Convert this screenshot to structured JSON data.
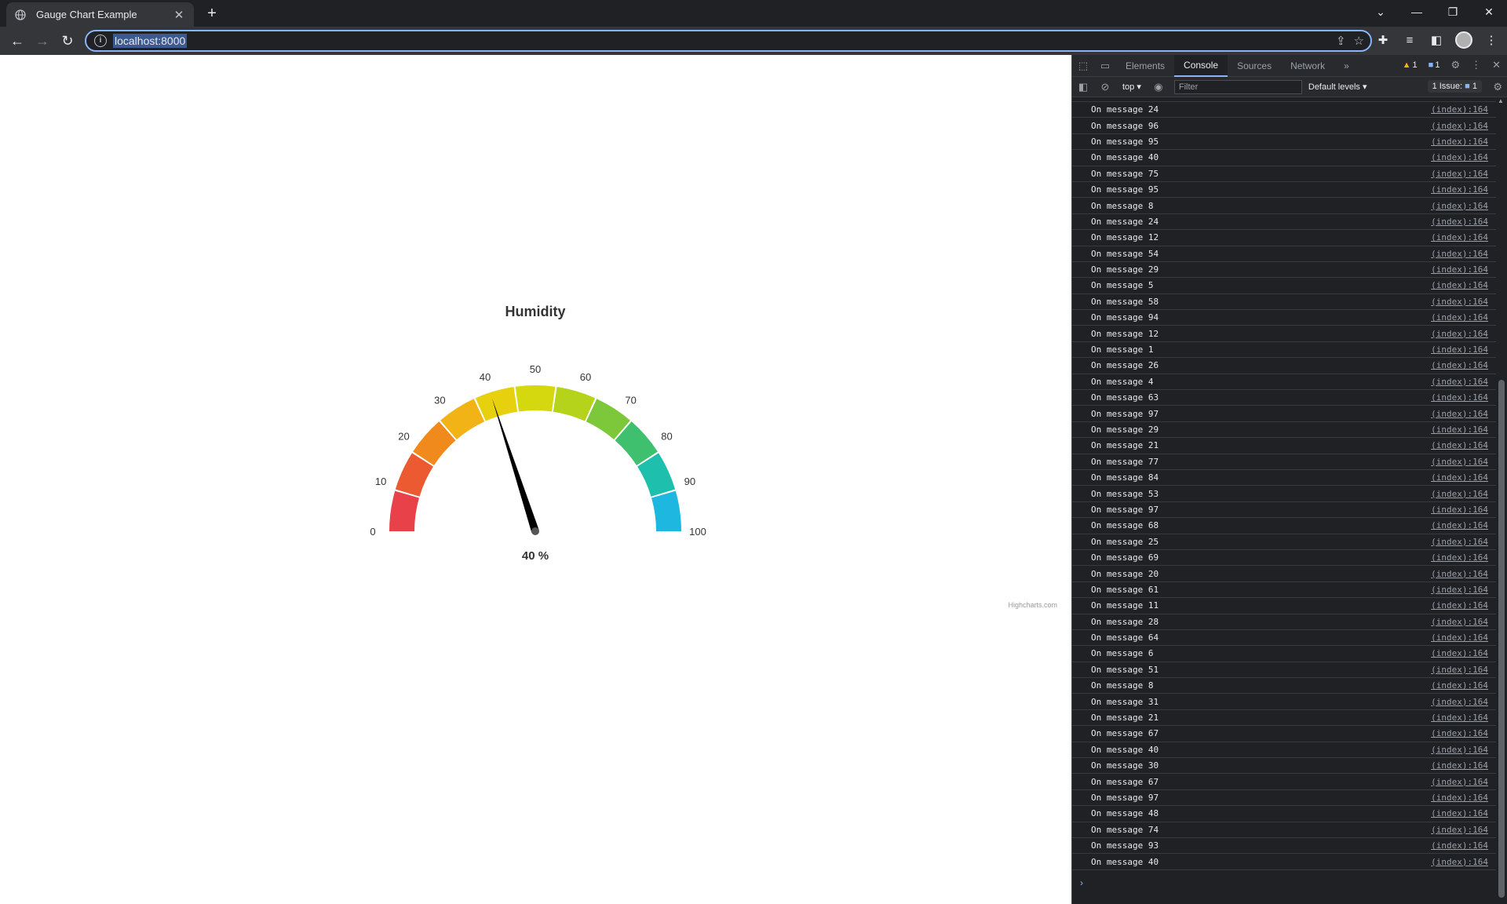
{
  "browser": {
    "tab_title": "Gauge Chart Example",
    "url": "localhost:8000",
    "new_tab_symbol": "+",
    "icons": [
      "globe-icon",
      "close-icon",
      "back-icon",
      "forward-icon",
      "reload-icon",
      "info-icon",
      "share-icon",
      "star-icon",
      "puzzle-icon",
      "media-icon",
      "sidebar-icon",
      "avatar",
      "menu-icon"
    ]
  },
  "devtools": {
    "tabs": [
      "Elements",
      "Console",
      "Sources",
      "Network"
    ],
    "active_tab": "Console",
    "more_tabs": "»",
    "warning_count": "1",
    "message_count": "1",
    "context": "top",
    "filter_placeholder": "Filter",
    "levels": "Default levels",
    "issues_label": "1 Issue:",
    "issues_count": "1",
    "prompt": "›",
    "logs": {
      "partial": {
        "msg": "On message 31",
        "src": "(index):164"
      },
      "items": [
        {
          "msg": "On message 24",
          "src": "(index):164"
        },
        {
          "msg": "On message 96",
          "src": "(index):164"
        },
        {
          "msg": "On message 95",
          "src": "(index):164"
        },
        {
          "msg": "On message 40",
          "src": "(index):164"
        },
        {
          "msg": "On message 75",
          "src": "(index):164"
        },
        {
          "msg": "On message 95",
          "src": "(index):164"
        },
        {
          "msg": "On message 8",
          "src": "(index):164"
        },
        {
          "msg": "On message 24",
          "src": "(index):164"
        },
        {
          "msg": "On message 12",
          "src": "(index):164"
        },
        {
          "msg": "On message 54",
          "src": "(index):164"
        },
        {
          "msg": "On message 29",
          "src": "(index):164"
        },
        {
          "msg": "On message 5",
          "src": "(index):164"
        },
        {
          "msg": "On message 58",
          "src": "(index):164"
        },
        {
          "msg": "On message 94",
          "src": "(index):164"
        },
        {
          "msg": "On message 12",
          "src": "(index):164"
        },
        {
          "msg": "On message 1",
          "src": "(index):164"
        },
        {
          "msg": "On message 26",
          "src": "(index):164"
        },
        {
          "msg": "On message 4",
          "src": "(index):164"
        },
        {
          "msg": "On message 63",
          "src": "(index):164"
        },
        {
          "msg": "On message 97",
          "src": "(index):164"
        },
        {
          "msg": "On message 29",
          "src": "(index):164"
        },
        {
          "msg": "On message 21",
          "src": "(index):164"
        },
        {
          "msg": "On message 77",
          "src": "(index):164"
        },
        {
          "msg": "On message 84",
          "src": "(index):164"
        },
        {
          "msg": "On message 53",
          "src": "(index):164"
        },
        {
          "msg": "On message 97",
          "src": "(index):164"
        },
        {
          "msg": "On message 68",
          "src": "(index):164"
        },
        {
          "msg": "On message 25",
          "src": "(index):164"
        },
        {
          "msg": "On message 69",
          "src": "(index):164"
        },
        {
          "msg": "On message 20",
          "src": "(index):164"
        },
        {
          "msg": "On message 61",
          "src": "(index):164"
        },
        {
          "msg": "On message 11",
          "src": "(index):164"
        },
        {
          "msg": "On message 28",
          "src": "(index):164"
        },
        {
          "msg": "On message 64",
          "src": "(index):164"
        },
        {
          "msg": "On message 6",
          "src": "(index):164"
        },
        {
          "msg": "On message 51",
          "src": "(index):164"
        },
        {
          "msg": "On message 8",
          "src": "(index):164"
        },
        {
          "msg": "On message 31",
          "src": "(index):164"
        },
        {
          "msg": "On message 21",
          "src": "(index):164"
        },
        {
          "msg": "On message 67",
          "src": "(index):164"
        },
        {
          "msg": "On message 40",
          "src": "(index):164"
        },
        {
          "msg": "On message 30",
          "src": "(index):164"
        },
        {
          "msg": "On message 67",
          "src": "(index):164"
        },
        {
          "msg": "On message 97",
          "src": "(index):164"
        },
        {
          "msg": "On message 48",
          "src": "(index):164"
        },
        {
          "msg": "On message 74",
          "src": "(index):164"
        },
        {
          "msg": "On message 93",
          "src": "(index):164"
        },
        {
          "msg": "On message 40",
          "src": "(index):164"
        }
      ]
    }
  },
  "chart_data": {
    "type": "gauge",
    "title": "Humidity",
    "min": 0,
    "max": 100,
    "value": 40,
    "value_label": "40 %",
    "ticks": [
      "0",
      "10",
      "20",
      "30",
      "40",
      "50",
      "60",
      "70",
      "80",
      "90",
      "100"
    ],
    "credits": "Highcharts.com",
    "colors": [
      "#e8414a",
      "#ec5a32",
      "#f08a1c",
      "#f2b316",
      "#e7d10e",
      "#d6d80f",
      "#b4d31a",
      "#7cc83a",
      "#3fc06f",
      "#1fbfae",
      "#1eb7e0"
    ],
    "needle_color": "#000000"
  }
}
